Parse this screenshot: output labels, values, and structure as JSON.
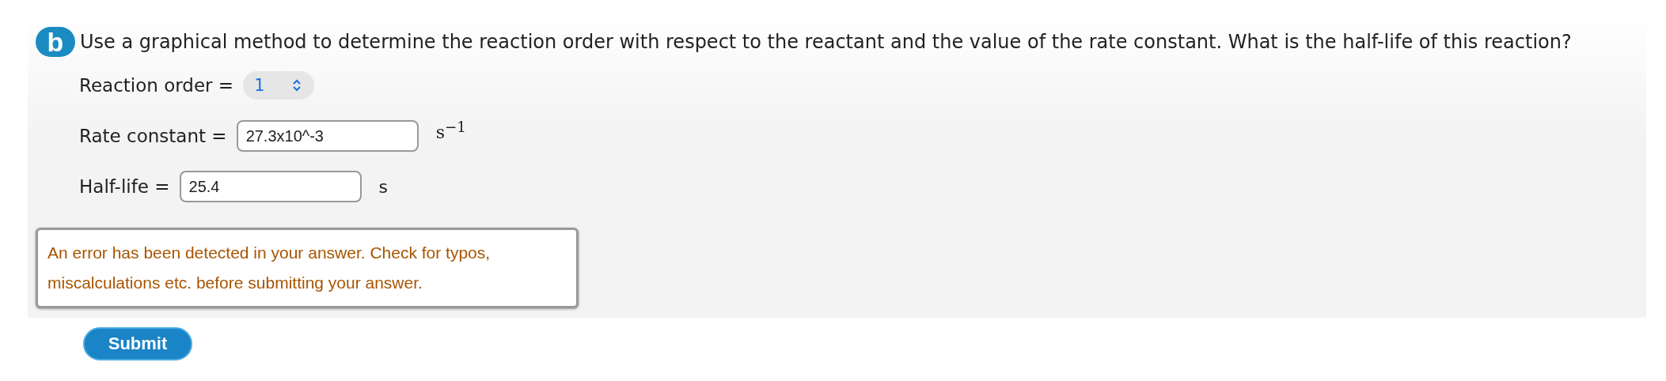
{
  "part": {
    "badge": "b",
    "question": "Use a graphical method to determine the reaction order with respect to the reactant and the value of the rate constant. What is the half-life of this reaction?"
  },
  "answers": [
    {
      "kind": "select",
      "label": "Reaction order =",
      "value": "1"
    },
    {
      "kind": "input",
      "label": "Rate constant =",
      "value": "27.3x10^-3",
      "unit": {
        "kind": "math",
        "text": "s$^{−1}$"
      }
    },
    {
      "kind": "input",
      "label": "Half-life =",
      "value": "25.4",
      "unit": {
        "kind": "plain",
        "text": "s"
      }
    }
  ],
  "error_message": "An error has been detected in your answer. Check for typos, miscalculations etc. before submitting your answer.",
  "submit_button": "Submit"
}
